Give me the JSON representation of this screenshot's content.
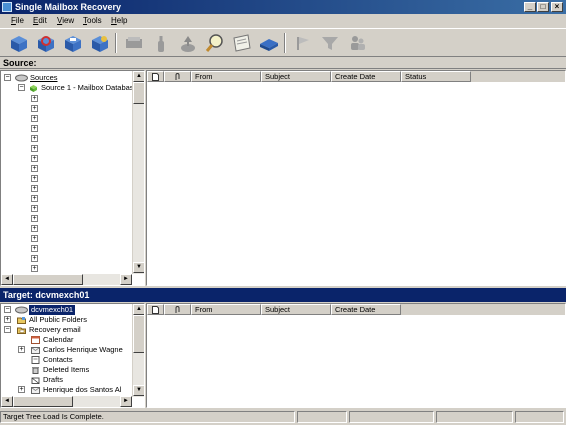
{
  "window": {
    "title": "Single Mailbox Recovery"
  },
  "menu": [
    {
      "label": "File",
      "u": "F",
      "rest": "ile"
    },
    {
      "label": "Edit",
      "u": "E",
      "rest": "dit"
    },
    {
      "label": "View",
      "u": "V",
      "rest": "iew"
    },
    {
      "label": "Tools",
      "u": "T",
      "rest": "ools"
    },
    {
      "label": "Help",
      "u": "H",
      "rest": "elp"
    }
  ],
  "source": {
    "header": "Source:",
    "tree": {
      "root": "Sources",
      "child": "Source 1 - Mailbox Databas",
      "collapsed_nodes": 18
    },
    "columns": [
      "",
      "",
      "From",
      "Subject",
      "Create Date",
      "Status"
    ]
  },
  "target": {
    "header": "Target: dcvmexch01",
    "tree": {
      "root": "dcvmexch01",
      "items": [
        {
          "label": "All Public Folders",
          "icon": "public-folders-icon"
        },
        {
          "label": "Recovery email",
          "icon": "mailbox-icon"
        },
        {
          "label": "Calendar",
          "icon": "calendar-icon"
        },
        {
          "label": "Carlos Henrique Wagne",
          "icon": "folder-icon"
        },
        {
          "label": "Contacts",
          "icon": "contacts-icon"
        },
        {
          "label": "Deleted Items",
          "icon": "trash-icon"
        },
        {
          "label": "Drafts",
          "icon": "drafts-icon"
        },
        {
          "label": "Henrique dos Santos Al",
          "icon": "folder-icon"
        }
      ]
    },
    "columns": [
      "",
      "",
      "From",
      "Subject",
      "Create Date"
    ]
  },
  "status": {
    "text": "Target Tree Load Is Complete."
  },
  "colors": {
    "title_bar": "#0a246a",
    "target_bar": "#0a246a",
    "chrome": "#d4d0c8"
  }
}
